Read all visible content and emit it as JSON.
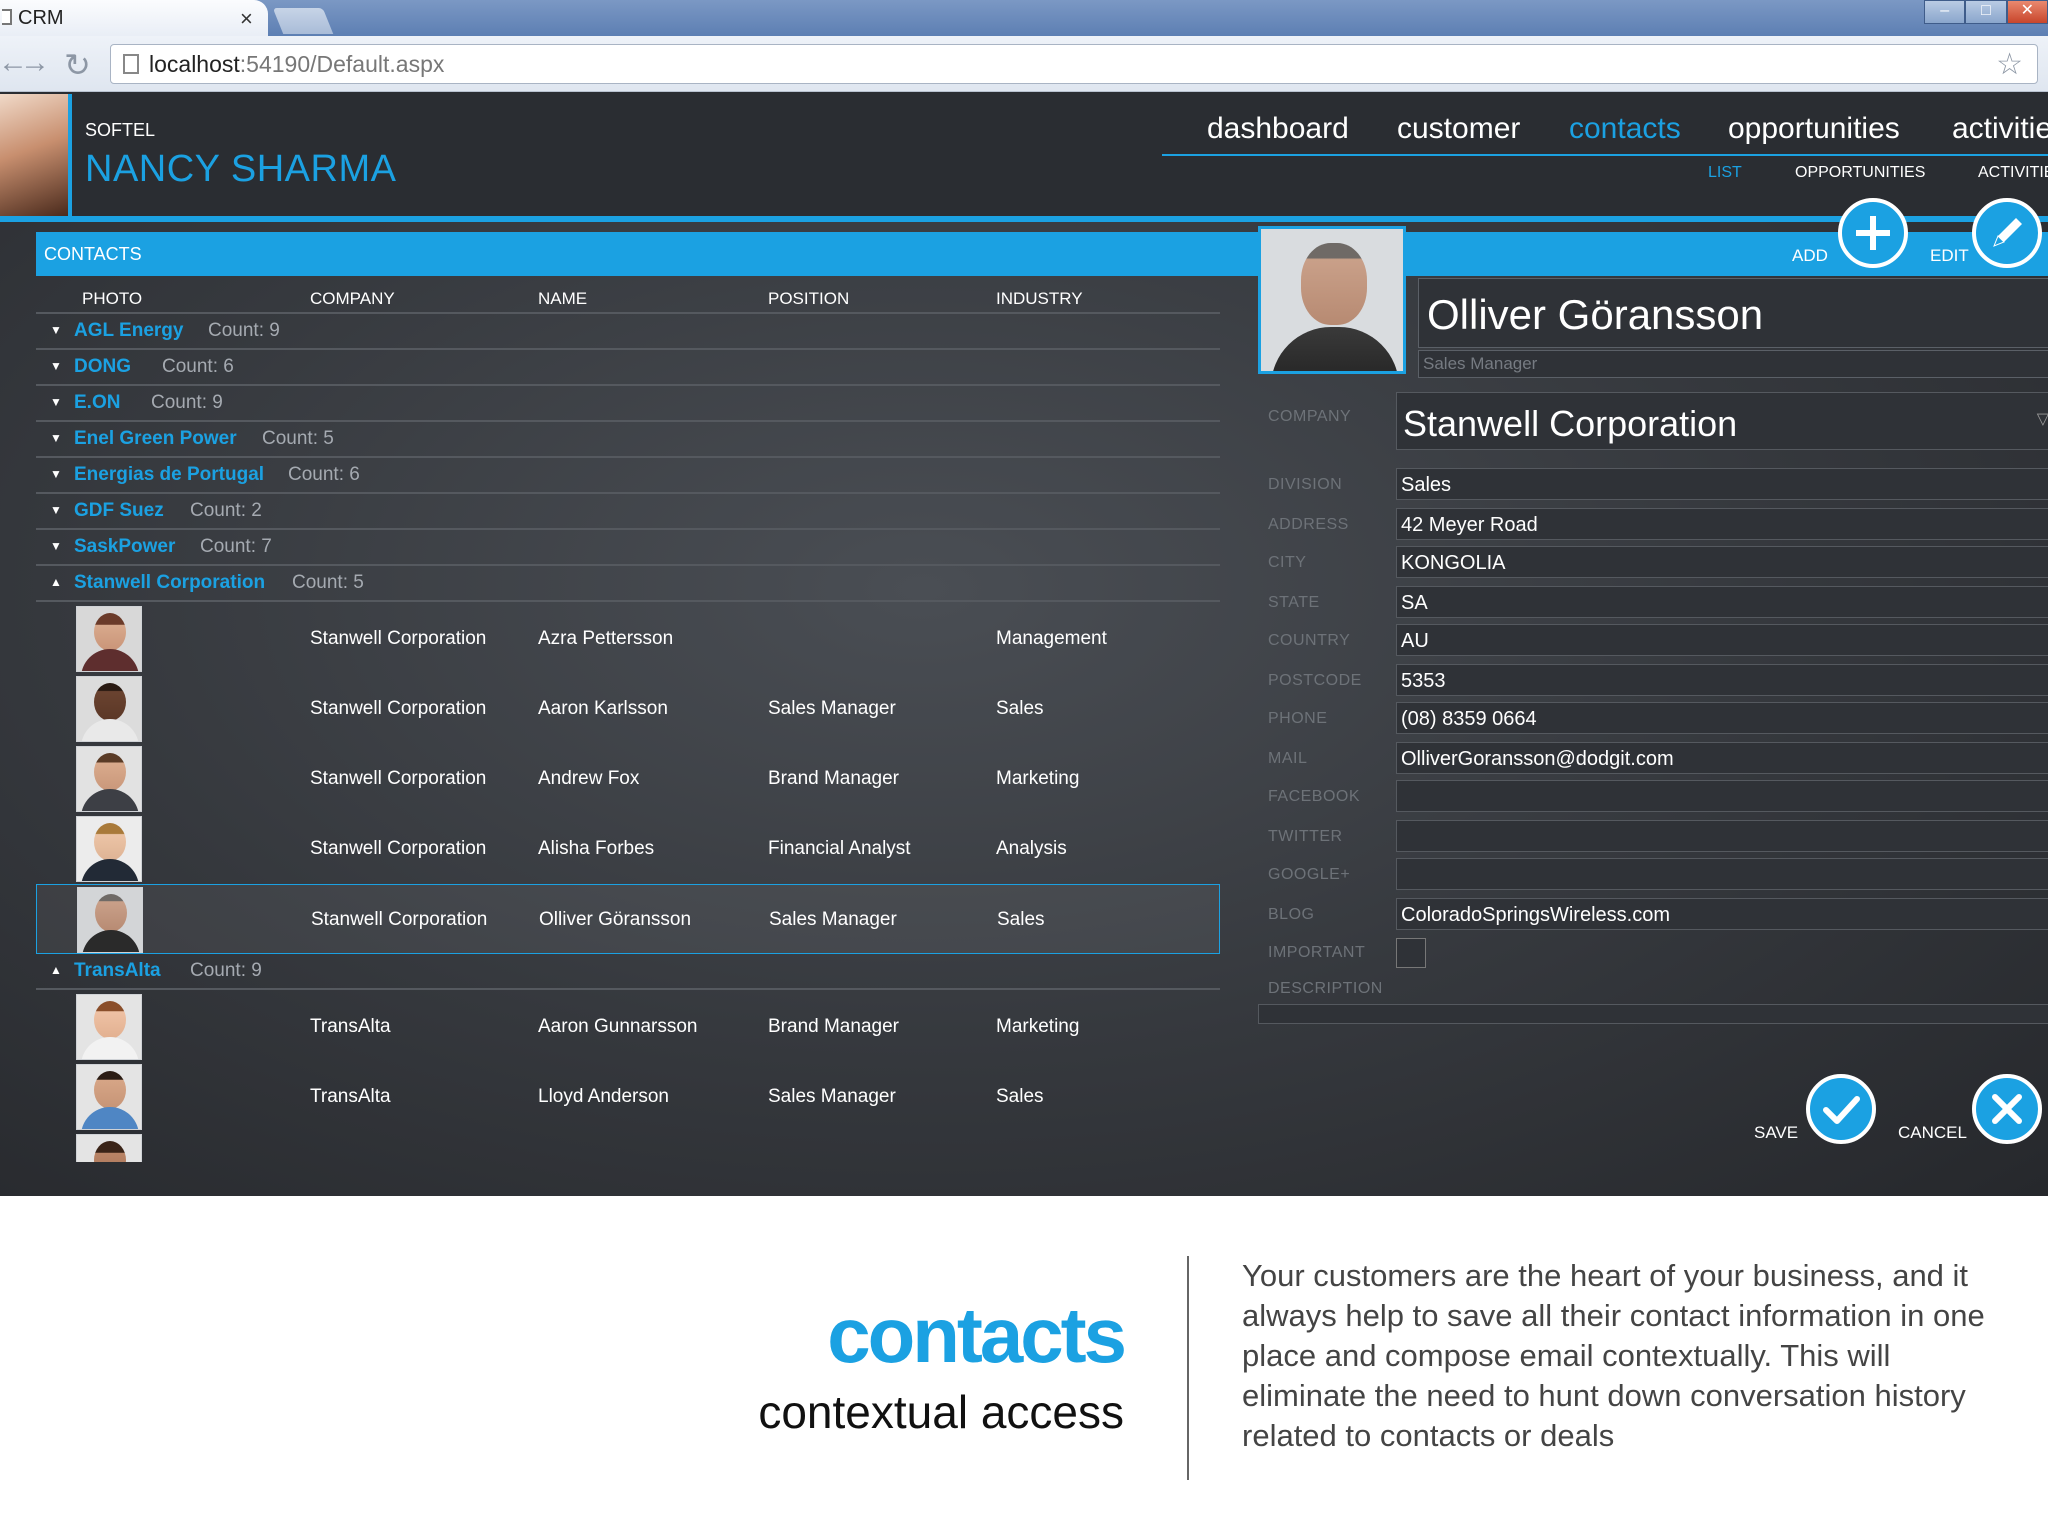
{
  "browser": {
    "tab_title": "CRM",
    "tab_close": "×",
    "url_host": "localhost",
    "url_rest": ":54190/Default.aspx"
  },
  "header": {
    "company": "SOFTEL",
    "user_name": "NANCY SHARMA",
    "nav": [
      "dashboard",
      "customer",
      "contacts",
      "opportunities",
      "activitie"
    ],
    "subnav": [
      "LIST",
      "OPPORTUNITIES",
      "ACTIVITIE"
    ]
  },
  "grid": {
    "title": "CONTACTS",
    "columns": [
      "PHOTO",
      "COMPANY",
      "NAME",
      "POSITION",
      "INDUSTRY"
    ],
    "groups_collapsed": [
      {
        "name": "AGL Energy",
        "count": "Count: 9"
      },
      {
        "name": "DONG",
        "count": "Count: 6"
      },
      {
        "name": "E.ON",
        "count": "Count: 9"
      },
      {
        "name": "Enel Green Power",
        "count": "Count: 5"
      },
      {
        "name": "Energias de Portugal",
        "count": "Count: 6"
      },
      {
        "name": "GDF Suez",
        "count": "Count: 2"
      },
      {
        "name": "SaskPower",
        "count": "Count: 7"
      }
    ],
    "group_stanwell": {
      "name": "Stanwell Corporation",
      "count": "Count: 5"
    },
    "rows_stanwell": [
      {
        "company": "Stanwell Corporation",
        "name": "Azra Pettersson",
        "position": "",
        "industry": "Management"
      },
      {
        "company": "Stanwell Corporation",
        "name": "Aaron Karlsson",
        "position": "Sales Manager",
        "industry": "Sales"
      },
      {
        "company": "Stanwell Corporation",
        "name": "Andrew Fox",
        "position": "Brand Manager",
        "industry": "Marketing"
      },
      {
        "company": "Stanwell Corporation",
        "name": "Alisha Forbes",
        "position": "Financial Analyst",
        "industry": "Analysis"
      },
      {
        "company": "Stanwell Corporation",
        "name": "Olliver Göransson",
        "position": "Sales Manager",
        "industry": "Sales"
      }
    ],
    "group_transalta": {
      "name": "TransAlta",
      "count": "Count: 9"
    },
    "rows_transalta": [
      {
        "company": "TransAlta",
        "name": "Aaron Gunnarsson",
        "position": "Brand Manager",
        "industry": "Marketing"
      },
      {
        "company": "TransAlta",
        "name": "Lloyd Anderson",
        "position": "Sales Manager",
        "industry": "Sales"
      }
    ]
  },
  "detail": {
    "add_label": "ADD",
    "edit_label": "EDIT",
    "name": "Olliver Göransson",
    "position": "Sales Manager",
    "company_label": "COMPANY",
    "company": "Stanwell Corporation",
    "fields": [
      {
        "label": "DIVISION",
        "value": "Sales"
      },
      {
        "label": "ADDRESS",
        "value": "42 Meyer Road"
      },
      {
        "label": "CITY",
        "value": "KONGOLIA"
      },
      {
        "label": "STATE",
        "value": "SA"
      },
      {
        "label": "COUNTRY",
        "value": "AU"
      },
      {
        "label": "POSTCODE",
        "value": "5353"
      },
      {
        "label": "PHONE",
        "value": "(08) 8359 0664"
      },
      {
        "label": "MAIL",
        "value": "OlliverGoransson@dodgit.com"
      },
      {
        "label": "FACEBOOK",
        "value": ""
      },
      {
        "label": "TWITTER",
        "value": ""
      },
      {
        "label": "GOOGLE+",
        "value": ""
      },
      {
        "label": "BLOG",
        "value": "ColoradoSpringsWireless.com"
      }
    ],
    "important_label": "IMPORTANT",
    "description_label": "DESCRIPTION",
    "save_label": "SAVE",
    "cancel_label": "CANCEL"
  },
  "promo": {
    "title": "contacts",
    "subtitle": "contextual access",
    "body": "Your customers are the heart of your business, and it always help to save all their contact information in one place and compose email contextually. This will eliminate the need to hunt down conversation history related to contacts or deals"
  },
  "colors": {
    "accent": "#1ba1e2",
    "background": "#35383d"
  }
}
